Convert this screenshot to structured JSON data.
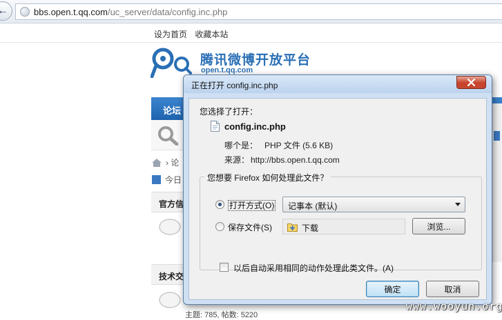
{
  "browser": {
    "url_host": "bbs.open.t.qq.com",
    "url_path": "/uc_server/data/config.inc.php"
  },
  "page": {
    "toplinks": [
      "设为首页",
      "收藏本站"
    ],
    "logo_title": "腾讯微博开放平台",
    "logo_sub": "open.t.qq.com",
    "nav_forum": "论坛",
    "crumb": "论",
    "today": "今日",
    "section1": "官方信",
    "section2": "技术交",
    "bottom_text": "主题: 785, 帖数: 5220"
  },
  "dialog": {
    "title": "正在打开 config.inc.php",
    "prompt": "您选择了打开：",
    "file_name": "config.inc.php",
    "type_label": "哪个是：",
    "type_value": "PHP 文件 (5.6 KB)",
    "source_label": "来源：",
    "source_value": "http://bbs.open.t.qq.com",
    "question": "您想要 Firefox 如何处理此文件？",
    "open_with_label": "打开方式(O)",
    "open_with_value": "记事本 (默认)",
    "save_label": "保存文件(S)",
    "save_folder": "下载",
    "browse_label": "浏览...",
    "auto_label": "以后自动采用相同的动作处理此类文件。(A)",
    "ok_label": "确定",
    "cancel_label": "取消",
    "open_with_selected": true
  },
  "watermark": "www.wooyun.org"
}
